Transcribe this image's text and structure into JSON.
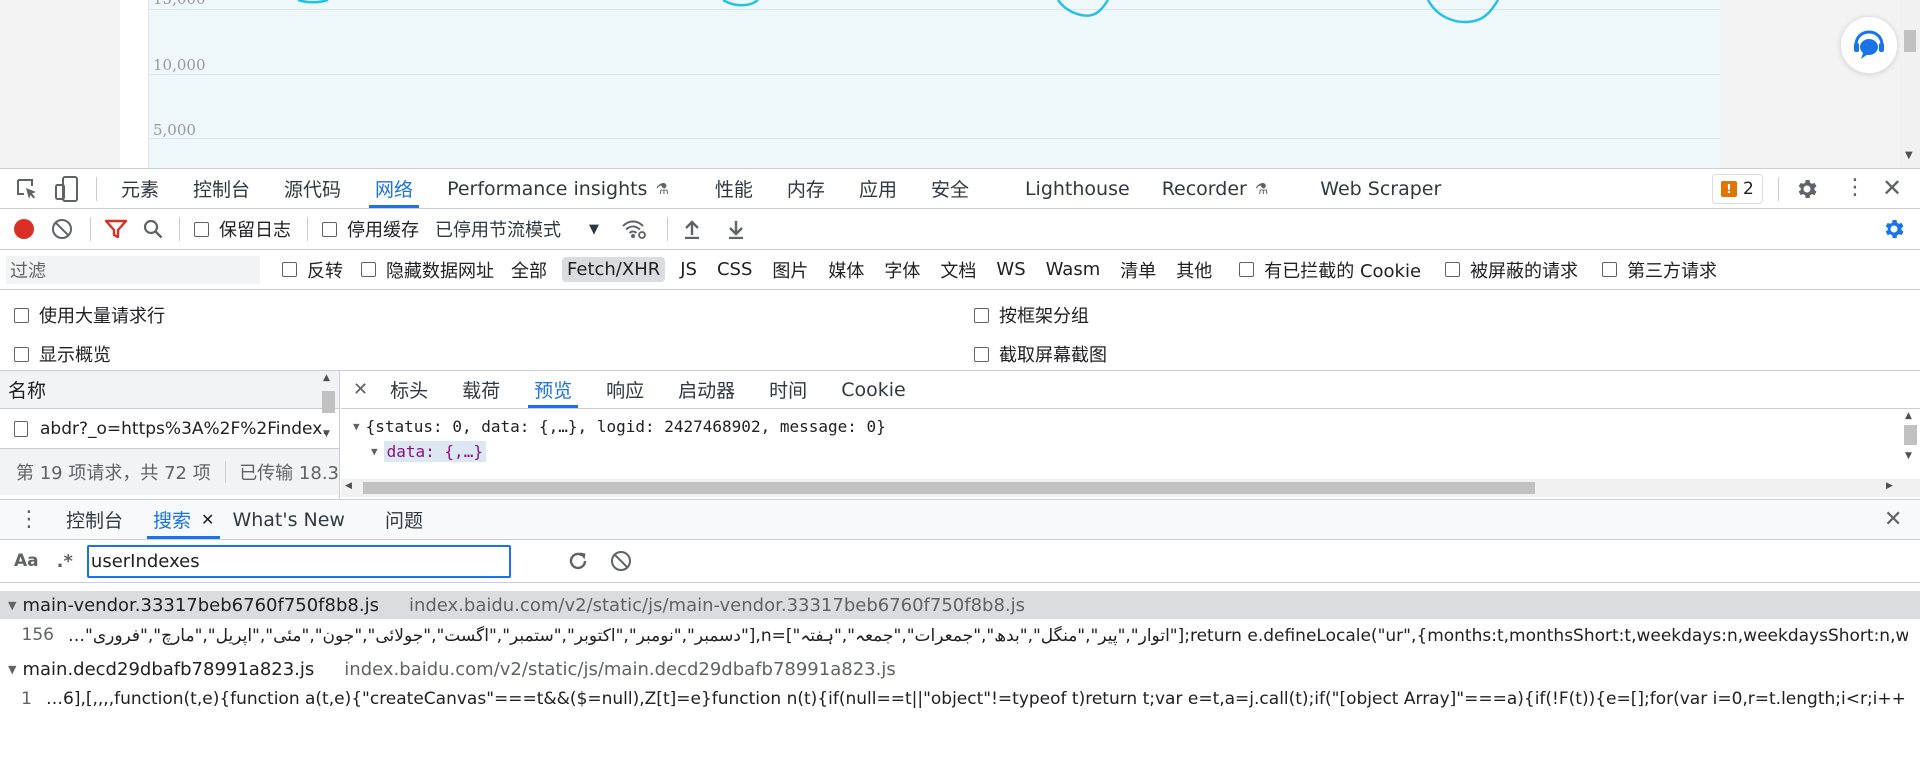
{
  "page_chart": {
    "y_ticks": [
      "15,000",
      "10,000",
      "5,000"
    ]
  },
  "devtools": {
    "main_tabs": [
      {
        "label": "元素"
      },
      {
        "label": "控制台"
      },
      {
        "label": "源代码"
      },
      {
        "label": "网络",
        "active": true
      },
      {
        "label": "Performance insights"
      },
      {
        "label": "性能"
      },
      {
        "label": "内存"
      },
      {
        "label": "应用"
      },
      {
        "label": "安全"
      },
      {
        "label": "Lighthouse"
      },
      {
        "label": "Recorder"
      },
      {
        "label": "Web Scraper"
      }
    ],
    "issues_count": "2",
    "network_toolbar": {
      "preserve_log": "保留日志",
      "disable_cache": "停用缓存",
      "throttle": "已停用节流模式"
    },
    "filter_bar": {
      "placeholder": "过滤",
      "invert": "反转",
      "hide_data_urls": "隐藏数据网址",
      "types": [
        "全部",
        "Fetch/XHR",
        "JS",
        "CSS",
        "图片",
        "媒体",
        "字体",
        "文档",
        "WS",
        "Wasm",
        "清单",
        "其他"
      ],
      "selected_type": "Fetch/XHR",
      "blocked_cookies": "有已拦截的 Cookie",
      "blocked_requests": "被屏蔽的请求",
      "third_party": "第三方请求"
    },
    "settings": {
      "big_rows": "使用大量请求行",
      "group_by_frame": "按框架分组",
      "show_overview": "显示概览",
      "capture_screenshots": "截取屏幕截图"
    },
    "request_list": {
      "header": "名称",
      "items": [
        "abdr?_o=https%3A%2F%2Findex."
      ],
      "status": "第 19 项请求，共 72 项",
      "transferred": "已传输 18.3"
    },
    "detail_tabs": [
      {
        "label": "标头"
      },
      {
        "label": "载荷"
      },
      {
        "label": "预览",
        "active": true
      },
      {
        "label": "响应"
      },
      {
        "label": "启动器"
      },
      {
        "label": "时间"
      },
      {
        "label": "Cookie"
      }
    ],
    "preview": {
      "line1": "{status: 0, data: {,…}, logid: 2427468902, message: 0}",
      "line2": "data: {,…}"
    },
    "drawer_tabs": [
      {
        "label": "控制台"
      },
      {
        "label": "搜索",
        "active": true
      },
      {
        "label": "What's New"
      },
      {
        "label": "问题"
      }
    ],
    "search": {
      "match_case": "Aa",
      "regex": ".*",
      "query": "userIndexes",
      "results": [
        {
          "file": "main-vendor.33317beb6760f750f8b8.js",
          "url": "index.baidu.com/v2/static/js/main-vendor.33317beb6760f750f8b8.js",
          "line_no": "156",
          "snippet": "…\"دسمبر\",\"نومبر\",\"اکتوبر\",\"ستمبر\",\"اگست\",\"جولائی\",\"جون\",\"مئی\",\"اپریل\",\"مارچ\",\"فروری\"],n=[\"اتوار\",\"پیر\",\"منگل\",\"بدھ\",\"جمعرات\",\"جمعہ\",\"ہفتہ\"];return e.defineLocale(\"ur\",{months:t,monthsShort:t,weekdays:n,weekdaysShort:n,weekd…"
        },
        {
          "file": "main.decd29dbafb78991a823.js",
          "url": "index.baidu.com/v2/static/js/main.decd29dbafb78991a823.js",
          "line_no": "1",
          "snippet": "…6],[,,,,function(t,e){function a(t,e){\"createCanvas\"===t&&($=null),Z[t]=e}function n(t){if(null==t||\"object\"!=typeof t)return t;var e=t,a=j.call(t);if(\"[object Array]\"===a){if(!F(t)){e=[];for(var i=0,r=t.length;i<r;i++)e[i]=n(t[i])}}else if(…"
        }
      ]
    }
  },
  "colors": {
    "accent": "#1a73e8",
    "record": "#d93025",
    "filter_active": "#d93025",
    "chart_line": "#29c1e3",
    "issues_badge": "#e37400"
  }
}
